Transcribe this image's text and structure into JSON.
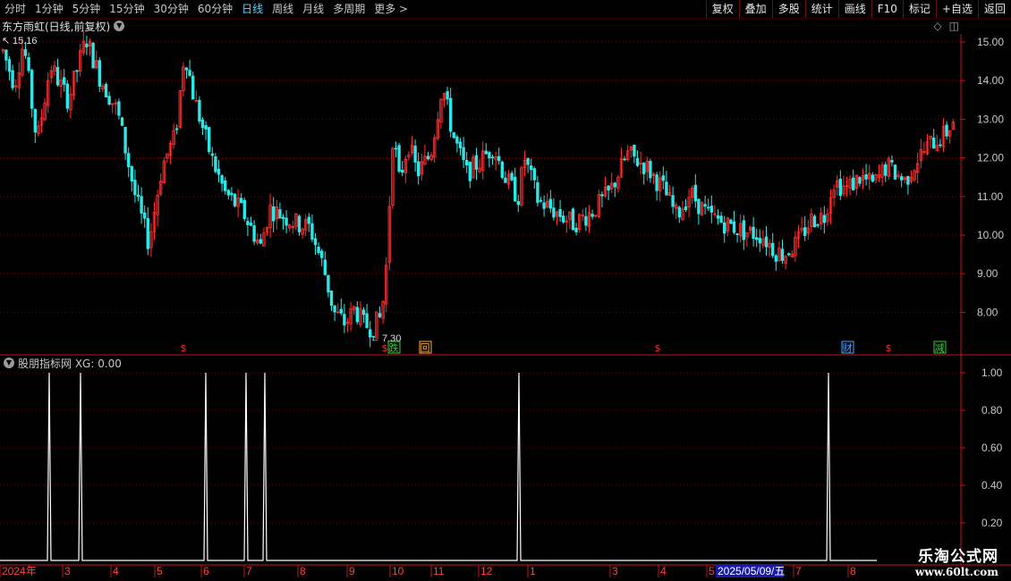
{
  "toolbar": {
    "periods": [
      {
        "label": "分时",
        "active": false
      },
      {
        "label": "1分钟",
        "active": false
      },
      {
        "label": "5分钟",
        "active": false
      },
      {
        "label": "15分钟",
        "active": false
      },
      {
        "label": "30分钟",
        "active": false
      },
      {
        "label": "60分钟",
        "active": false
      },
      {
        "label": "日线",
        "active": true
      },
      {
        "label": "周线",
        "active": false
      },
      {
        "label": "月线",
        "active": false
      },
      {
        "label": "多周期",
        "active": false
      },
      {
        "label": "更多 >",
        "active": false
      }
    ],
    "right_buttons": [
      "复权",
      "叠加",
      "多股",
      "统计",
      "画线",
      "F10",
      "标记",
      "+自选",
      "返回"
    ]
  },
  "main_chart": {
    "title": "东方雨虹(日线,前复权)",
    "high_label": "15.16",
    "low_label": "7.30",
    "y_ticks": [
      "15.00",
      "14.00",
      "13.00",
      "12.00",
      "11.00",
      "10.00",
      "9.00",
      "8.00"
    ],
    "markers": [
      {
        "text": "$",
        "color": "#ff3030"
      },
      {
        "text": "$",
        "color": "#ff3030"
      },
      {
        "text": "跌",
        "color": "#3ad13a"
      },
      {
        "text": "回",
        "color": "#ffb040"
      },
      {
        "text": "$",
        "color": "#ff3030"
      },
      {
        "text": "财",
        "color": "#4aa8ff"
      },
      {
        "text": "$",
        "color": "#ff3030"
      },
      {
        "text": "减",
        "color": "#3ad13a"
      }
    ]
  },
  "indicator": {
    "title": "股朋指标网 XG: 0.00",
    "y_ticks": [
      "1.00",
      "0.80",
      "0.60",
      "0.40",
      "0.20"
    ]
  },
  "x_axis": {
    "labels": [
      "2024年",
      "3",
      "4",
      "5",
      "6",
      "7",
      "8",
      "9",
      "10",
      "11",
      "12",
      "1",
      "3",
      "4",
      "5",
      "6",
      "7",
      "8"
    ],
    "cursor_date": "2025/05/09/五"
  },
  "watermark": {
    "title": "乐淘公式网",
    "url": "www.60lt.com"
  },
  "colors": {
    "up": "#ff3030",
    "down": "#2ee6e6",
    "grid": "#7a0000",
    "axis": "#c01818",
    "signal": "#ffffff"
  }
}
